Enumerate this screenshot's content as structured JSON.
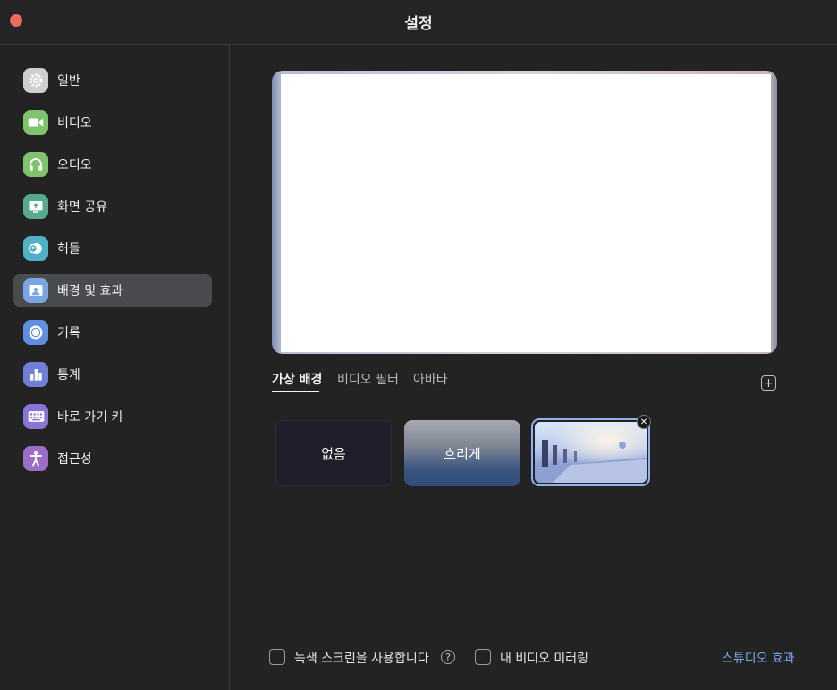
{
  "window": {
    "title": "설정"
  },
  "sidebar": {
    "items": [
      {
        "key": "general",
        "label": "일반",
        "icon": "gear-icon",
        "color": "#cfcfcf",
        "active": false
      },
      {
        "key": "video",
        "label": "비디오",
        "icon": "video-camera-icon",
        "color": "#7fc36c",
        "active": false
      },
      {
        "key": "audio",
        "label": "오디오",
        "icon": "headphones-icon",
        "color": "#7fc36c",
        "active": false
      },
      {
        "key": "share",
        "label": "화면 공유",
        "icon": "share-screen-icon",
        "color": "#56ab8c",
        "active": false
      },
      {
        "key": "huddle",
        "label": "허들",
        "icon": "huddle-icon",
        "color": "#4fb2c9",
        "active": false
      },
      {
        "key": "background",
        "label": "배경 및 효과",
        "icon": "background-effects-icon",
        "color": "#7aa6e6",
        "active": true
      },
      {
        "key": "recording",
        "label": "기록",
        "icon": "recording-icon",
        "color": "#5f8fe0",
        "active": false
      },
      {
        "key": "statistics",
        "label": "통계",
        "icon": "bar-chart-icon",
        "color": "#6f7fd6",
        "active": false
      },
      {
        "key": "shortcuts",
        "label": "바로 가기 키",
        "icon": "keyboard-icon",
        "color": "#8a75d6",
        "active": false
      },
      {
        "key": "accessibility",
        "label": "접근성",
        "icon": "accessibility-icon",
        "color": "#9b6ec8",
        "active": false
      }
    ]
  },
  "tabs": [
    {
      "label": "가상 배경",
      "active": true
    },
    {
      "label": "비디오 필터",
      "active": false
    },
    {
      "label": "아바타",
      "active": false
    }
  ],
  "backgrounds": [
    {
      "label": "없음",
      "selected": false
    },
    {
      "label": "흐리게",
      "selected": false
    },
    {
      "label": "",
      "selected": true
    }
  ],
  "footer": {
    "green_screen_label": "녹색 스크린을 사용합니다",
    "green_screen_checked": false,
    "mirror_label": "내 비디오 미러링",
    "mirror_checked": false,
    "studio_effects_label": "스튜디오 효과"
  },
  "colors": {
    "accent": "#76a9ec",
    "close": "#ed6a5e",
    "selected_border": "#8fb2ee"
  }
}
